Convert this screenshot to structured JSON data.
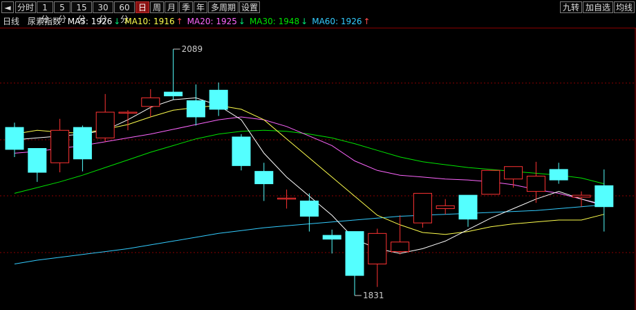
{
  "toolbar": {
    "left_buttons": [
      "分时",
      "1分",
      "5分",
      "15分",
      "30分",
      "60分",
      "日",
      "周",
      "月",
      "季",
      "年",
      "多周期",
      "设置"
    ],
    "active": "日",
    "right_buttons": [
      "九转",
      "加自选",
      "均线"
    ]
  },
  "legend": {
    "period": "日线",
    "name": "尿素指数",
    "items": [
      {
        "label": "MA5: 1926",
        "arrow": "↓",
        "color": "#ffffff",
        "arrow_color": "#00e676"
      },
      {
        "label": "MA10: 1916",
        "arrow": "↑",
        "color": "#ffff4d",
        "arrow_color": "#ff4d4d"
      },
      {
        "label": "MA20: 1925",
        "arrow": "↓",
        "color": "#ff66ff",
        "arrow_color": "#00e676"
      },
      {
        "label": "MA30: 1948",
        "arrow": "↓",
        "color": "#00e600",
        "arrow_color": "#00e676"
      },
      {
        "label": "MA60: 1926",
        "arrow": "↑",
        "color": "#33ccff",
        "arrow_color": "#ff4d4d"
      }
    ]
  },
  "chart_data": {
    "type": "candlestick",
    "title": "尿素指数",
    "ylim": [
      1818,
      2110
    ],
    "grid": "horizontal-dashed",
    "colors": {
      "up": "#ff3333",
      "down": "#54ffff",
      "ma5": "#ffffff",
      "ma10": "#ffff4d",
      "ma20": "#ff66ff",
      "ma30": "#00e600",
      "ma60": "#33ccff",
      "grid": "#8b0000"
    },
    "annotations": [
      {
        "text": "2089",
        "value": 2089,
        "index": 7
      },
      {
        "text": "1831",
        "value": 1831,
        "index": 15
      }
    ],
    "candles": [
      {
        "o": 2007,
        "h": 2012,
        "l": 1976,
        "c": 1984
      },
      {
        "o": 1985,
        "h": 1985,
        "l": 1950,
        "c": 1960
      },
      {
        "o": 1970,
        "h": 2016,
        "l": 1960,
        "c": 2004
      },
      {
        "o": 2007,
        "h": 2009,
        "l": 1961,
        "c": 1974
      },
      {
        "o": 1996,
        "h": 2042,
        "l": 1992,
        "c": 2023
      },
      {
        "o": 2022,
        "h": 2025,
        "l": 2004,
        "c": 2023
      },
      {
        "o": 2029,
        "h": 2047,
        "l": 2018,
        "c": 2038
      },
      {
        "o": 2044,
        "h": 2089,
        "l": 2036,
        "c": 2040
      },
      {
        "o": 2035,
        "h": 2052,
        "l": 2009,
        "c": 2018
      },
      {
        "o": 2046,
        "h": 2054,
        "l": 2019,
        "c": 2026
      },
      {
        "o": 1997,
        "h": 2000,
        "l": 1962,
        "c": 1967
      },
      {
        "o": 1961,
        "h": 1970,
        "l": 1930,
        "c": 1948
      },
      {
        "o": 1933,
        "h": 1942,
        "l": 1922,
        "c": 1933
      },
      {
        "o": 1930,
        "h": 1938,
        "l": 1898,
        "c": 1914
      },
      {
        "o": 1894,
        "h": 1900,
        "l": 1875,
        "c": 1890
      },
      {
        "o": 1898,
        "h": 1898,
        "l": 1831,
        "c": 1852
      },
      {
        "o": 1864,
        "h": 1901,
        "l": 1840,
        "c": 1896
      },
      {
        "o": 1877,
        "h": 1915,
        "l": 1874,
        "c": 1887
      },
      {
        "o": 1907,
        "h": 1936,
        "l": 1902,
        "c": 1938
      },
      {
        "o": 1922,
        "h": 1932,
        "l": 1916,
        "c": 1925
      },
      {
        "o": 1936,
        "h": 1934,
        "l": 1903,
        "c": 1911
      },
      {
        "o": 1937,
        "h": 1961,
        "l": 1941,
        "c": 1962
      },
      {
        "o": 1953,
        "h": 1965,
        "l": 1944,
        "c": 1966
      },
      {
        "o": 1940,
        "h": 1971,
        "l": 1928,
        "c": 1956
      },
      {
        "o": 1963,
        "h": 1970,
        "l": 1948,
        "c": 1952
      },
      {
        "o": 1934,
        "h": 1940,
        "l": 1924,
        "c": 1936
      },
      {
        "o": 1946,
        "h": 1963,
        "l": 1898,
        "c": 1924
      }
    ],
    "ma": {
      "ma5": [
        1994,
        1996,
        1998,
        2000,
        2004,
        2015,
        2028,
        2036,
        2038,
        2030,
        2015,
        1980,
        1955,
        1935,
        1915,
        1890,
        1880,
        1875,
        1880,
        1888,
        1900,
        1912,
        1922,
        1932,
        1940,
        1932,
        1926
      ],
      "ma10": [
        2000,
        2004,
        2002,
        2001,
        2005,
        2010,
        2018,
        2025,
        2028,
        2030,
        2026,
        2015,
        1995,
        1975,
        1955,
        1935,
        1915,
        1905,
        1897,
        1895,
        1898,
        1903,
        1906,
        1908,
        1910,
        1910,
        1916
      ],
      "ma20": [
        1980,
        1982,
        1985,
        1988,
        1992,
        1996,
        2000,
        2005,
        2010,
        2015,
        2018,
        2015,
        2008,
        1998,
        1988,
        1972,
        1962,
        1957,
        1955,
        1953,
        1952,
        1950,
        1947,
        1942,
        1938,
        1932,
        1925
      ],
      "ma30": [
        1938,
        1944,
        1950,
        1957,
        1965,
        1973,
        1981,
        1988,
        1995,
        2000,
        2003,
        2004,
        2003,
        2000,
        1996,
        1990,
        1983,
        1976,
        1971,
        1968,
        1965,
        1963,
        1961,
        1959,
        1957,
        1954,
        1948
      ],
      "ma60": [
        1864,
        1868,
        1871,
        1874,
        1877,
        1880,
        1884,
        1888,
        1892,
        1896,
        1899,
        1902,
        1904,
        1906,
        1908,
        1910,
        1912,
        1914,
        1915,
        1916,
        1917,
        1918,
        1919,
        1920,
        1922,
        1924,
        1926
      ]
    }
  }
}
